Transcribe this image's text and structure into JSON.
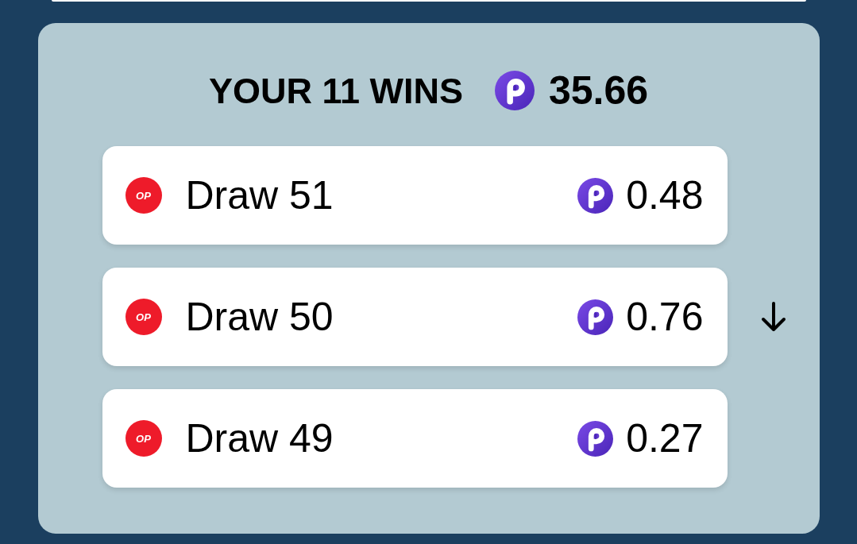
{
  "summary": {
    "title": "YOUR 11 WINS",
    "amount": "35.66"
  },
  "wins": [
    {
      "badge": "OP",
      "label": "Draw 51",
      "amount": "0.48"
    },
    {
      "badge": "OP",
      "label": "Draw 50",
      "amount": "0.76"
    },
    {
      "badge": "OP",
      "label": "Draw 49",
      "amount": "0.27"
    }
  ]
}
